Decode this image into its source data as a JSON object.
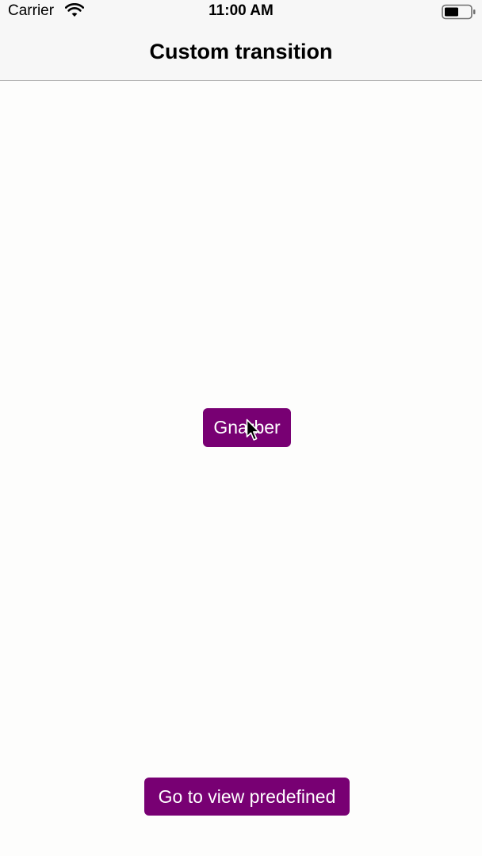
{
  "status_bar": {
    "carrier": "Carrier",
    "time": "11:00 AM",
    "wifi_icon": "wifi-icon",
    "battery_icon": "battery-icon"
  },
  "nav_bar": {
    "title": "Custom transition"
  },
  "main": {
    "grabber_button_label": "Gnarber",
    "predefined_button_label": "Go to view predefined"
  },
  "cursor": {
    "icon": "mouse-pointer-icon"
  },
  "colors": {
    "button_background": "#780073",
    "button_text": "#ffffff",
    "nav_background": "#f7f7f7",
    "page_background": "#fdfdfc"
  }
}
